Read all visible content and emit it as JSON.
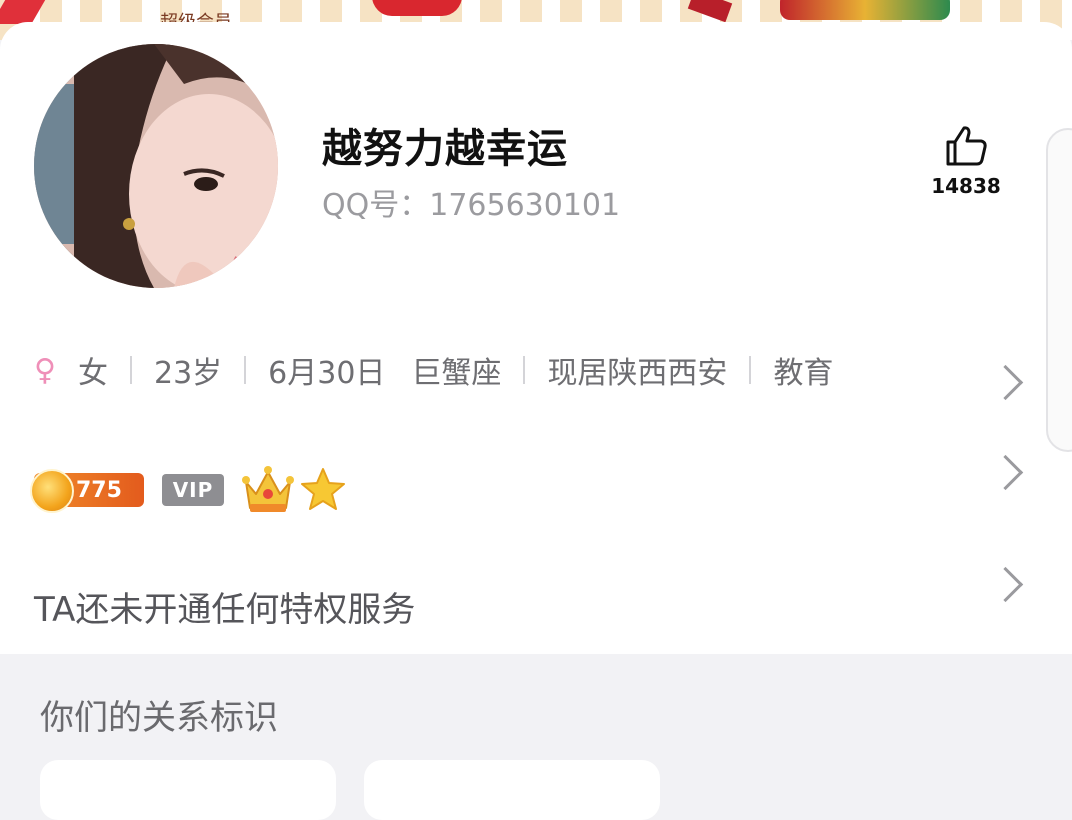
{
  "banner": {
    "text": "超级会员"
  },
  "profile": {
    "nickname": "越努力越幸运",
    "qq_label": "QQ号：",
    "qq_number": "1765630101",
    "likes": "14838"
  },
  "info": {
    "gender": "女",
    "age": "23岁",
    "birthday": "6月30日",
    "zodiac": "巨蟹座",
    "location": "现居陕西西安",
    "occupation": "教育"
  },
  "badges": {
    "coin_level": "775",
    "vip_label": "VIP",
    "icons": [
      "coin-icon",
      "crown-icon",
      "star-icon"
    ]
  },
  "privilege_text": "TA还未开通任何特权服务",
  "relationship_title": "你们的关系标识",
  "colors": {
    "female": "#ef8fb8",
    "coin_badge": "#e35b1d",
    "vip_badge": "#8e8e92"
  }
}
